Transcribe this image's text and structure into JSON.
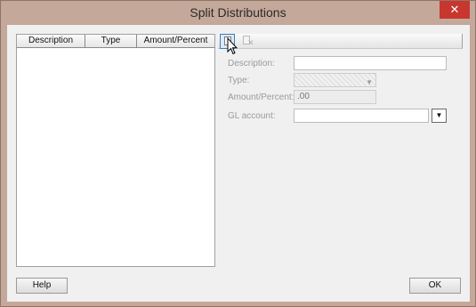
{
  "window": {
    "title": "Split Distributions",
    "close_glyph": "✕"
  },
  "grid": {
    "columns": [
      "Description",
      "Type",
      "Amount/Percent"
    ]
  },
  "toolbar": {
    "new_icon": "new-document-icon",
    "delete_icon": "delete-document-icon"
  },
  "form": {
    "description_label": "Description:",
    "description_value": "",
    "type_label": "Type:",
    "type_value": "",
    "amount_label": "Amount/Percent:",
    "amount_value": ".00",
    "gl_label": "GL account:",
    "gl_value": ""
  },
  "buttons": {
    "help": "Help",
    "ok": "OK"
  }
}
